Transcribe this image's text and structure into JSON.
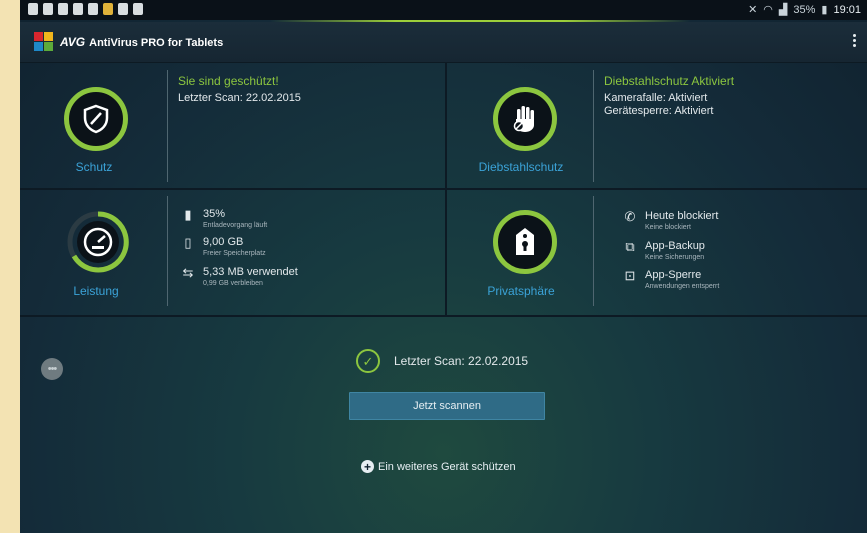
{
  "statusbar": {
    "battery": "35%",
    "time": "19:01"
  },
  "app": {
    "brand": "AVG",
    "title": "AntiVirus PRO for Tablets"
  },
  "protection": {
    "label": "Schutz",
    "heading": "Sie sind geschützt!",
    "last_scan": "Letzter Scan: 22.02.2015"
  },
  "antitheft": {
    "label": "Diebstahlschutz",
    "heading": "Diebstahlschutz Aktiviert",
    "lines": [
      "Kamerafalle: Aktiviert",
      "Gerätesperre: Aktiviert"
    ]
  },
  "performance": {
    "label": "Leistung",
    "items": [
      {
        "icon": "battery-icon",
        "title": "35%",
        "sub": "Entladevorgang läuft"
      },
      {
        "icon": "phone-storage-icon",
        "title": "9,00 GB",
        "sub": "Freier Speicherplatz"
      },
      {
        "icon": "data-transfer-icon",
        "title": "5,33 MB verwendet",
        "sub": "0,99 GB verbleiben"
      }
    ]
  },
  "privacy": {
    "label": "Privatsphäre",
    "items": [
      {
        "icon": "block-call-icon",
        "title": "Heute blockiert",
        "sub": "Keine blockiert"
      },
      {
        "icon": "app-backup-icon",
        "title": "App-Backup",
        "sub": "Keine Sicherungen"
      },
      {
        "icon": "app-lock-icon",
        "title": "App-Sperre",
        "sub": "Anwendungen entsperrt"
      }
    ]
  },
  "bottom": {
    "last_scan": "Letzter Scan: 22.02.2015",
    "scan_button": "Jetzt scannen",
    "add_device": "Ein weiteres Gerät schützen"
  },
  "colors": {
    "accent_green": "#8cc63f",
    "label_blue": "#3ba3d8",
    "button_blue": "#2f6b86"
  }
}
